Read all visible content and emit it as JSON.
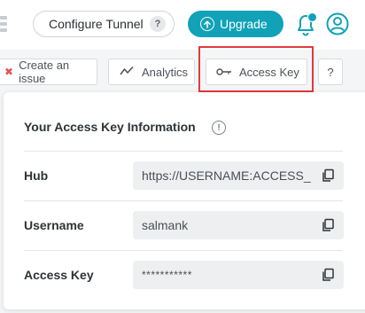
{
  "header": {
    "configure_label": "Configure Tunnel",
    "configure_help": "?",
    "upgrade_label": "Upgrade"
  },
  "tabs": {
    "create_issue": "Create an issue",
    "analytics": "Analytics",
    "access_key": "Access Key",
    "help": "?"
  },
  "panel": {
    "title": "Your Access Key Information",
    "info_symbol": "!",
    "rows": [
      {
        "label": "Hub",
        "value": "https://USERNAME:ACCESS_"
      },
      {
        "label": "Username",
        "value": "salmank"
      },
      {
        "label": "Access Key",
        "value": "***********"
      }
    ]
  },
  "colors": {
    "accent": "#11a2b8",
    "highlight": "#e0393e",
    "issue_icon": "#e0565b"
  }
}
